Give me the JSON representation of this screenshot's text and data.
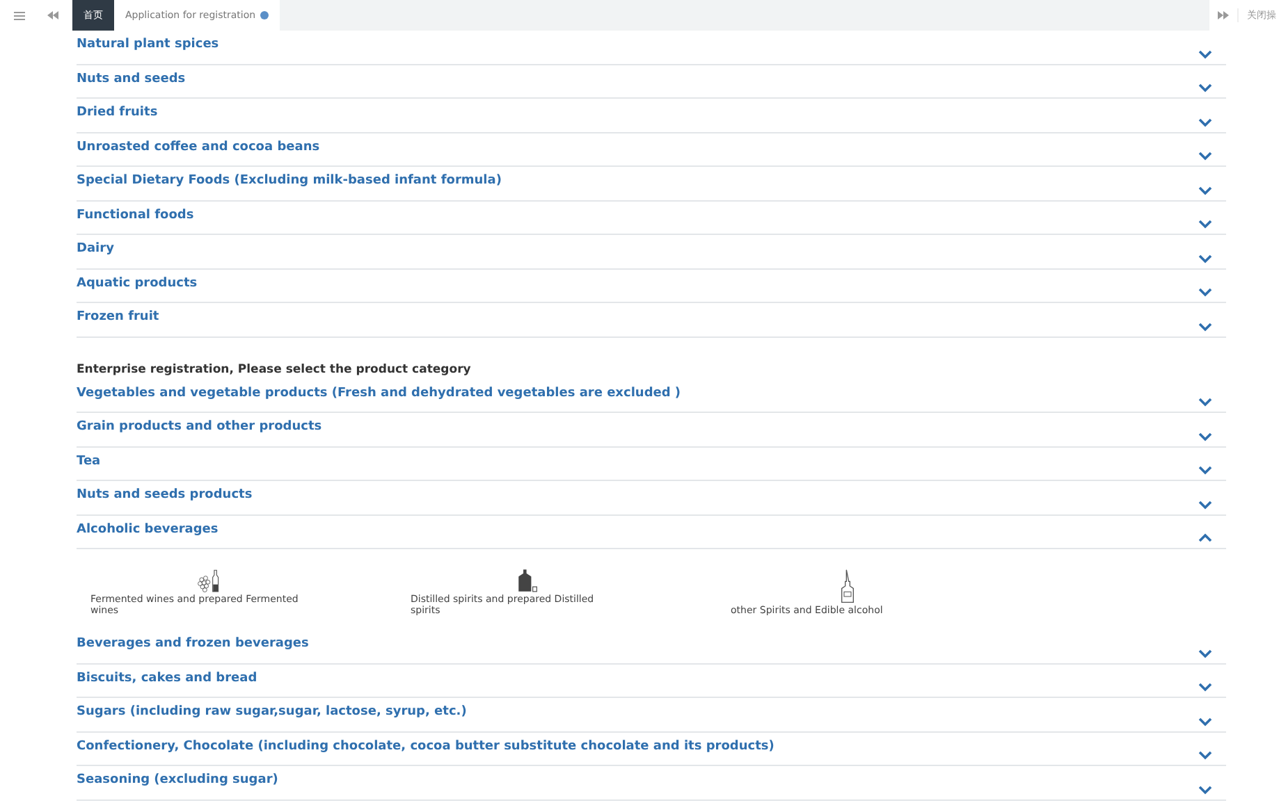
{
  "tab_bar": {
    "tabs": [
      {
        "label": "首页",
        "selected": true,
        "closable": false
      },
      {
        "label": "Application for registration",
        "selected": false,
        "closable": true
      }
    ],
    "close_ops": "关闭操"
  },
  "sections": [
    {
      "items": [
        {
          "label": "Natural plant spices",
          "expanded": false
        },
        {
          "label": "Nuts and seeds",
          "expanded": false
        },
        {
          "label": "Dried fruits",
          "expanded": false
        },
        {
          "label": "Unroasted coffee and cocoa beans",
          "expanded": false
        },
        {
          "label": "Special Dietary Foods  (Excluding milk-based infant formula)",
          "expanded": false
        },
        {
          "label": "Functional foods",
          "expanded": false
        },
        {
          "label": "Dairy",
          "expanded": false
        },
        {
          "label": "Aquatic products",
          "expanded": false
        },
        {
          "label": "Frozen fruit",
          "expanded": false
        }
      ]
    },
    {
      "heading": "Enterprise registration, Please select the product category",
      "items": [
        {
          "label": "Vegetables and vegetable products  (Fresh and dehydrated vegetables are excluded )",
          "expanded": false
        },
        {
          "label": "Grain products and other products",
          "expanded": false
        },
        {
          "label": "Tea",
          "expanded": false
        },
        {
          "label": "Nuts and seeds products",
          "expanded": false
        },
        {
          "label": "Alcoholic beverages",
          "expanded": true,
          "options": [
            {
              "kind": "wine",
              "label": "Fermented wines and prepared Fermented wines"
            },
            {
              "kind": "spirits",
              "label": "Distilled spirits and prepared Distilled spirits"
            },
            {
              "kind": "alcohol",
              "label": "other Spirits and Edible alcohol"
            }
          ]
        },
        {
          "label": "Beverages and frozen beverages",
          "expanded": false
        },
        {
          "label": "Biscuits, cakes and bread",
          "expanded": false
        },
        {
          "label": "Sugars (including raw sugar,sugar, lactose, syrup, etc.)",
          "expanded": false
        },
        {
          "label": "Confectionery, Chocolate (including chocolate, cocoa butter substitute chocolate and its products)",
          "expanded": false
        },
        {
          "label": "Seasoning (excluding sugar)",
          "expanded": false
        }
      ]
    }
  ]
}
